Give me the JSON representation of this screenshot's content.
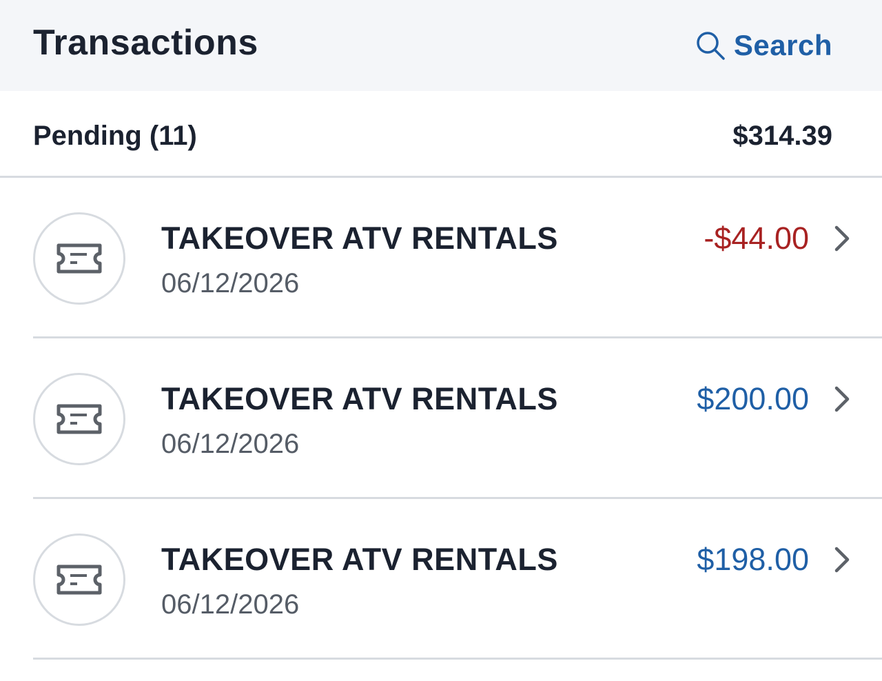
{
  "header": {
    "title": "Transactions",
    "search_label": "Search",
    "search_icon": "search-icon"
  },
  "pending": {
    "label": "Pending (11)",
    "total": "$314.39"
  },
  "colors": {
    "accent": "#1f5fa6",
    "negative": "#a82222",
    "header_bg": "#f4f6f9"
  },
  "transactions": [
    {
      "merchant": "TAKEOVER ATV RENTALS",
      "date": "06/12/2026",
      "amount": "-$44.00",
      "type": "debit",
      "icon": "ticket-icon"
    },
    {
      "merchant": "TAKEOVER ATV RENTALS",
      "date": "06/12/2026",
      "amount": "$200.00",
      "type": "credit",
      "icon": "ticket-icon"
    },
    {
      "merchant": "TAKEOVER ATV RENTALS",
      "date": "06/12/2026",
      "amount": "$198.00",
      "type": "credit",
      "icon": "ticket-icon"
    }
  ]
}
